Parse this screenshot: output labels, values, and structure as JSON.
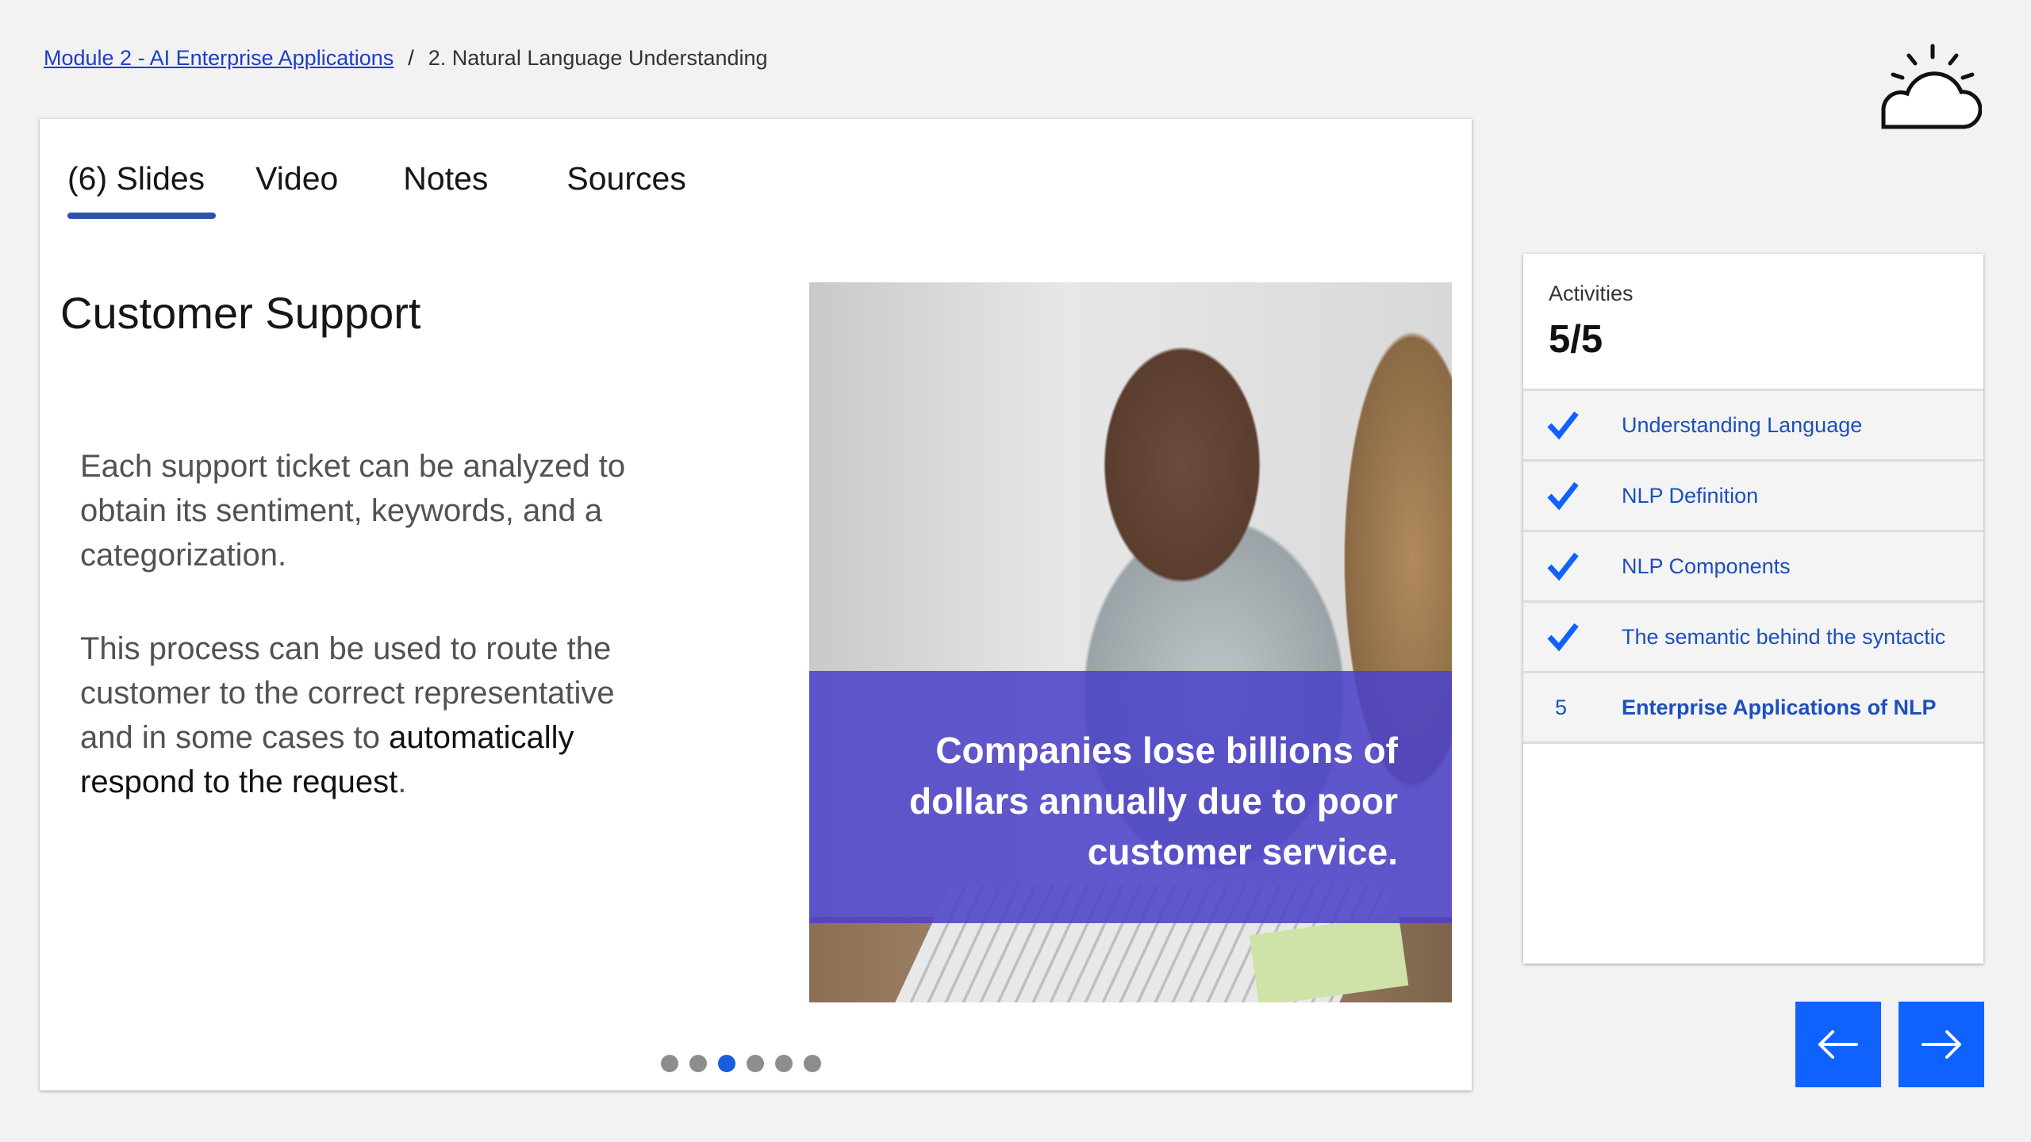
{
  "breadcrumb": {
    "module_link": "Module 2 - AI Enterprise Applications",
    "separator": "/",
    "current": "2. Natural Language Understanding"
  },
  "logo": {
    "icon": "cloud-sun-icon"
  },
  "tabs": [
    {
      "label": "(6) Slides",
      "active": true
    },
    {
      "label": "Video",
      "active": false
    },
    {
      "label": "Notes",
      "active": false
    },
    {
      "label": "Sources",
      "active": false
    }
  ],
  "slide": {
    "title": "Customer Support",
    "paragraph1": "Each support ticket can be analyzed to obtain its sentiment, keywords, and a categorization.",
    "paragraph2_prefix": "This process can be used to route the customer to the correct representative and in some cases to ",
    "paragraph2_bold": "automatically respond to the request",
    "paragraph2_suffix": ".",
    "image_caption": "Companies lose billions of dollars annually due to poor customer service.",
    "total_dots": 6,
    "active_dot": 3
  },
  "activities": {
    "label": "Activities",
    "count": "5/5",
    "items": [
      {
        "marker": "checkmark-icon",
        "label": "Understanding Language"
      },
      {
        "marker": "checkmark-icon",
        "label": "NLP Definition"
      },
      {
        "marker": "checkmark-icon",
        "label": "NLP Components"
      },
      {
        "marker": "checkmark-icon",
        "label": "The semantic behind the syntactic"
      },
      {
        "marker": "5",
        "label": "Enterprise Applications of NLP",
        "current": true
      }
    ]
  },
  "nav": {
    "prev_icon": "arrow-left-icon",
    "next_icon": "arrow-right-icon"
  },
  "colors": {
    "accent_blue": "#0f62fe",
    "link_blue": "#1c4fbf",
    "overlay_purple": "#4c42c8",
    "tab_underline": "#2c52ad"
  }
}
